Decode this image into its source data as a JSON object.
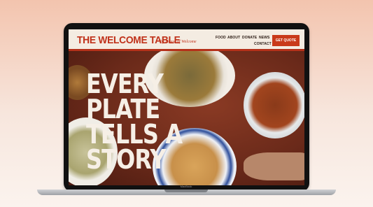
{
  "site": {
    "brand": "THE WELCOME TABLE",
    "brand_sub": "by House of Welcome",
    "nav": [
      "FOOD",
      "ABOUT",
      "DONATE",
      "NEWS",
      "CONTACT"
    ],
    "cta": "GET QUOTE",
    "hero_lines": [
      "EVERY",
      "PLATE",
      "TELLS A",
      "STORY"
    ]
  },
  "device": {
    "label": "MacBook"
  },
  "colors": {
    "accent": "#c93a1a",
    "topbar": "#f4ece2",
    "hero_text": "#f6efe6"
  }
}
